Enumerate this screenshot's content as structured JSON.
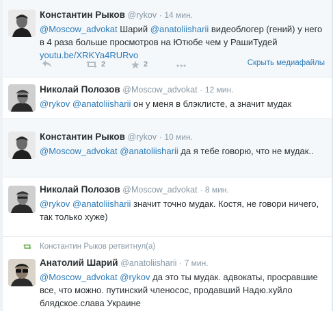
{
  "tweets": [
    {
      "name": "Константин Рыков",
      "handle": "@rykov",
      "dot": "·",
      "time": "14 мин.",
      "mention1": "@Moscow_advokat",
      "text_a": " Шарий ",
      "mention2": "@anatoliisharii",
      "text_b": " видеоблогер (гений) у него в 4 раза больше просмотров на Ютюбе чем у РашиТудей",
      "url": "youtu.be/XRKYa4RURvo",
      "retweets": "2",
      "favorites": "2",
      "media_label": "Скрыть медиафайлы"
    },
    {
      "name": "Николай Полозов",
      "handle": "@Moscow_advokat",
      "dot": "·",
      "time": "12 мин.",
      "mention1": "@rykov",
      "mention2": "@anatoliisharii",
      "text": " он у меня в блэклисте, а значит мудак"
    },
    {
      "name": "Константин Рыков",
      "handle": "@rykov",
      "dot": "·",
      "time": "10 мин.",
      "mention1": "@Moscow_advokat",
      "mention2": "@anatoliisharii",
      "text": " да я тебе говорю, что не мудак.."
    },
    {
      "name": "Николай Полозов",
      "handle": "@Moscow_advokat",
      "dot": "·",
      "time": "8 мин.",
      "mention1": "@rykov",
      "mention2": "@anatoliisharii",
      "text": " значит точно мудак. Костя, не говори ничего, так только хуже)"
    },
    {
      "retweet_label": "Константин Рыков ретвитнул(а)",
      "name": "Анатолий Шарий",
      "handle": "@anatoliisharii",
      "dot": "·",
      "time": "7 мин.",
      "mention1": "@Moscow_advokat",
      "mention2": "@rykov",
      "text": " да это ты мудак. адвокаты, просравшие все, что можно. путинский членосос, продавший Надю.хуйло блядское.слава Украине"
    }
  ],
  "colors": {
    "link": "#2b7bb9",
    "muted": "#8899a6",
    "retweet_green": "#5fa847",
    "bg_highlight": "#f5f8fa"
  },
  "icons": [
    "reply-icon",
    "retweet-icon",
    "favorite-icon",
    "more-icon"
  ]
}
